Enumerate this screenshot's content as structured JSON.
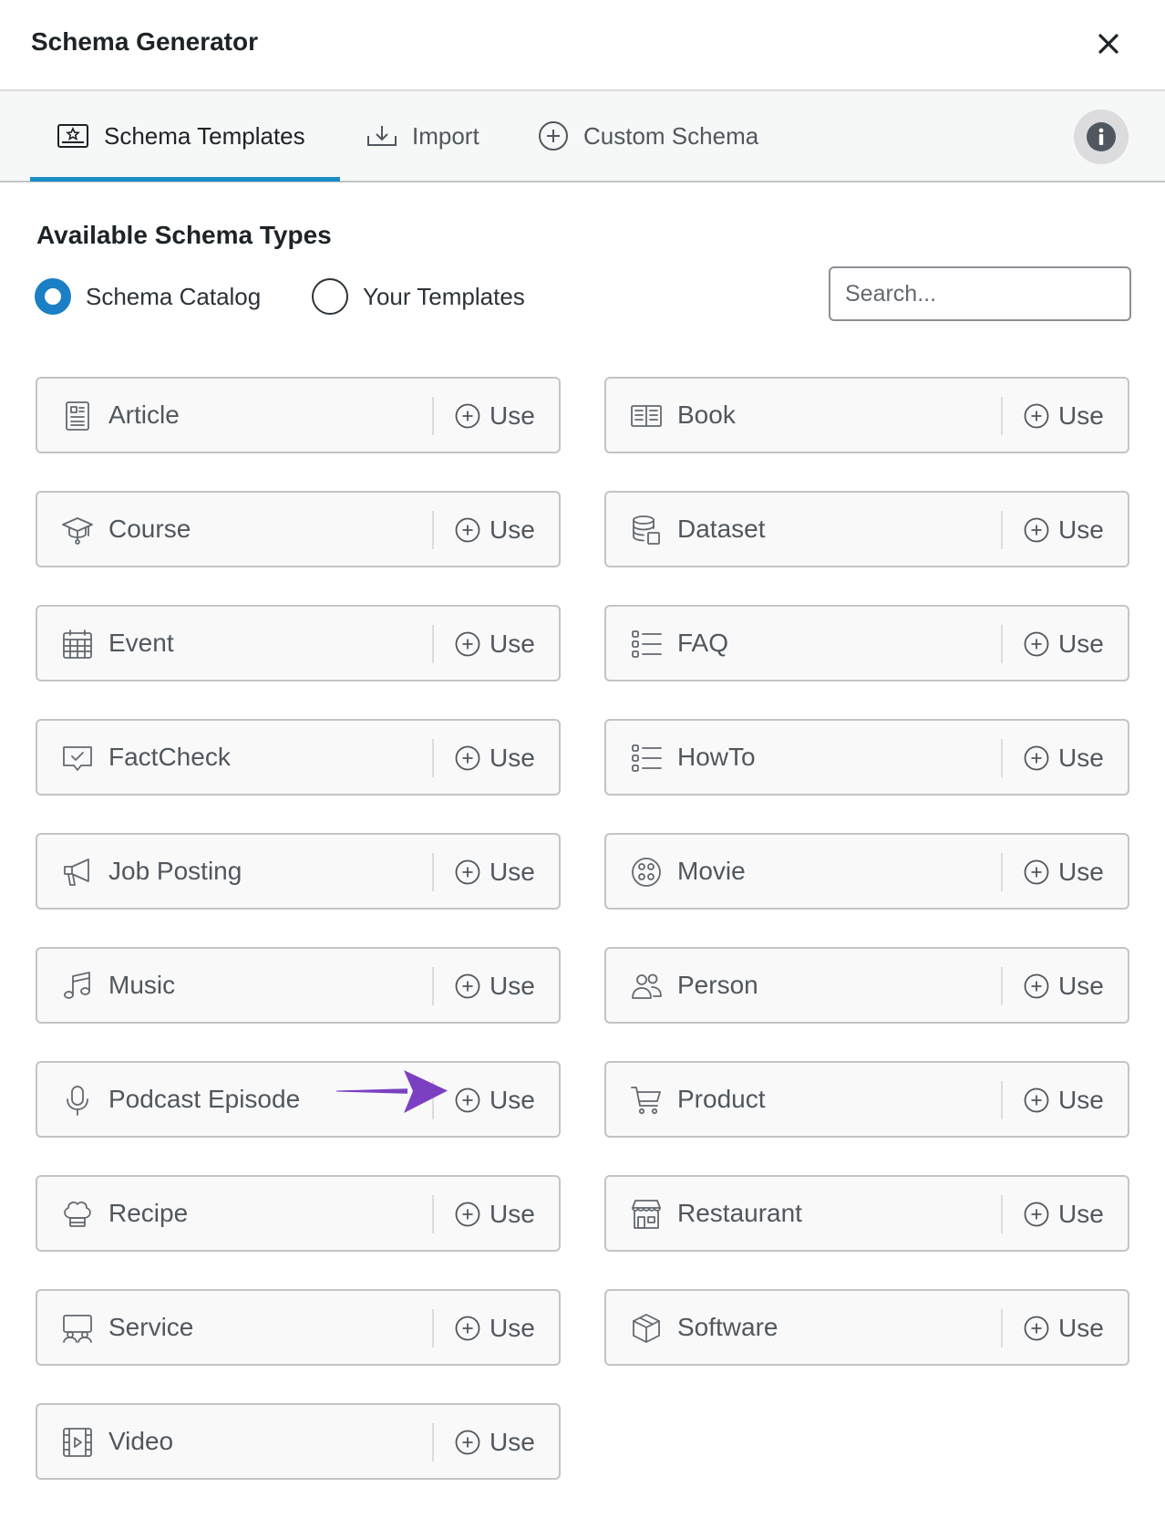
{
  "header": {
    "title": "Schema Generator"
  },
  "tabs": [
    {
      "label": "Schema Templates",
      "icon": "schema-templates-icon",
      "active": true
    },
    {
      "label": "Import",
      "icon": "import-icon",
      "active": false
    },
    {
      "label": "Custom Schema",
      "icon": "plus-circle-icon",
      "active": false
    }
  ],
  "section": {
    "title": "Available Schema Types",
    "radios": [
      {
        "label": "Schema Catalog",
        "checked": true
      },
      {
        "label": "Your Templates",
        "checked": false
      }
    ],
    "search": {
      "placeholder": "Search...",
      "value": ""
    }
  },
  "use_label": "Use",
  "schemas": [
    {
      "name": "Article",
      "icon": "article-icon"
    },
    {
      "name": "Book",
      "icon": "book-icon"
    },
    {
      "name": "Course",
      "icon": "graduation-cap-icon"
    },
    {
      "name": "Dataset",
      "icon": "database-icon"
    },
    {
      "name": "Event",
      "icon": "calendar-icon"
    },
    {
      "name": "FAQ",
      "icon": "list-icon"
    },
    {
      "name": "FactCheck",
      "icon": "factcheck-icon"
    },
    {
      "name": "HowTo",
      "icon": "list-icon"
    },
    {
      "name": "Job Posting",
      "icon": "megaphone-icon"
    },
    {
      "name": "Movie",
      "icon": "film-reel-icon"
    },
    {
      "name": "Music",
      "icon": "music-note-icon"
    },
    {
      "name": "Person",
      "icon": "people-icon"
    },
    {
      "name": "Podcast Episode",
      "icon": "microphone-icon"
    },
    {
      "name": "Product",
      "icon": "cart-icon"
    },
    {
      "name": "Recipe",
      "icon": "chef-hat-icon"
    },
    {
      "name": "Restaurant",
      "icon": "storefront-icon"
    },
    {
      "name": "Service",
      "icon": "service-icon"
    },
    {
      "name": "Software",
      "icon": "package-icon"
    },
    {
      "name": "Video",
      "icon": "video-icon"
    }
  ],
  "colors": {
    "accent": "#1a7fc4",
    "tab_indicator": "#1a8dc7",
    "arrow": "#7b40c2",
    "card_border": "#c3c4c7"
  }
}
